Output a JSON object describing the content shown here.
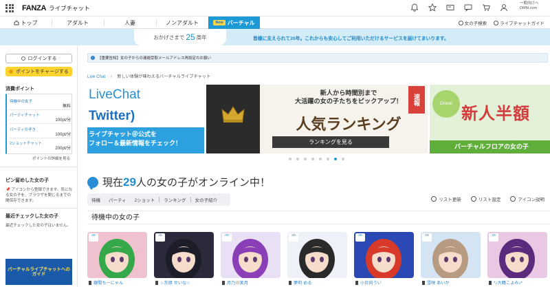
{
  "header": {
    "logo": "FANZA",
    "logo_sub": "ライブチャット",
    "account_line1": "一般向けへ",
    "account_line2": "DMM.com"
  },
  "nav": {
    "tabs": [
      {
        "label": "トップ"
      },
      {
        "label": "アダルト"
      },
      {
        "label": "人妻"
      },
      {
        "label": "ノンアダルト"
      },
      {
        "label": "バーチャル",
        "badge": "New"
      }
    ],
    "right": [
      "女の子検索",
      "ライブチャットガイド"
    ]
  },
  "anniversary": {
    "prefix": "おかげさまで",
    "years": "25",
    "suffix": "周年",
    "message": "皆様に支えられて25年。これからも安心してご利用いただけるサービスを届けてまいります。"
  },
  "sidebar": {
    "login": "ログインする",
    "charge": "ポイントをチャージする",
    "points_title": "消費ポイント",
    "points": [
      {
        "label": "待機中の女子",
        "value": "無料"
      },
      {
        "label": "パーティチャット",
        "value": "100pt/分"
      },
      {
        "label": "パーティのぞき",
        "value": "100pt/分"
      },
      {
        "label": "2ショットチャット",
        "value": "200pt/分"
      }
    ],
    "points_more": "ポイントの詳細を見る",
    "pinned_title": "ピン留めした女の子",
    "pinned_text": "📌 アイコンから登録できます。気になる女の子を、ブラウザを閉じるまでの間保存できます。",
    "recent_title": "最近チェックした女の子",
    "recent_text": "最近チェックした女の子はいません。",
    "banner_text": "バーチャルライブチャットへのガイド"
  },
  "notice": {
    "tag": "【重要告知】",
    "text": "女の子からの連絡受取メールアドレス再設定のお願い"
  },
  "breadcrumb": {
    "home": "Live Chat",
    "current": "新しい体験が味わえるバーチャルライブチャット"
  },
  "carousel": {
    "slide1": {
      "line1": "LiveChat",
      "line2": "Twitter)",
      "line3": "ライブチャット＠公式を\nフォロー＆最新情報をチェック！"
    },
    "slide2": {
      "line1": "新人から時間別まで\n大活躍の女の子たちをピックアップ！",
      "title": "人気ランキング",
      "button": "ランキングを見る",
      "ribbon": "速報"
    },
    "slide3": {
      "circle": "Check!",
      "title": "新人半額",
      "bar": "バーチャルフロアの女の子"
    },
    "dots": 8,
    "active_dot": 6
  },
  "online": {
    "prefix": "現在",
    "count": "29",
    "suffix": "人の女の子がオンライン中！"
  },
  "filters": [
    "待機",
    "パーティ",
    "2ショット",
    "ランキング",
    "女の子紹介"
  ],
  "tools": [
    "リスト更新",
    "リスト設定",
    "アイコン説明"
  ],
  "section_title": "待機中の女の子",
  "cards": [
    {
      "name": "鏡間ちーにゃん",
      "badge": "2D",
      "bg": "#f0c2cf",
      "hair": "#35a84a"
    },
    {
      "name": "☆灰原 せいな☆",
      "badge": "3D",
      "bg": "#2a2a3c",
      "hair": "#1d1d2a"
    },
    {
      "name": "月乃川美月",
      "badge": "2D",
      "bg": "#e9e0f5",
      "hair": "#8a3fb6"
    },
    {
      "name": "夢莉 める",
      "badge": "2D",
      "bg": "#eef2f8",
      "hair": "#2a2a2a"
    },
    {
      "name": "小日向うい",
      "badge": "3D",
      "bg": "#2b49b5",
      "hair": "#d83a2a"
    },
    {
      "name": "雪咲 あいか",
      "badge": "3D",
      "bg": "#d4e4f2",
      "hair": "#b69a82"
    },
    {
      "name": "*♪大鶴こよみ♪*",
      "badge": "2D",
      "bg": "#e9c8e4",
      "hair": "#5c2a7c"
    }
  ],
  "colors": {
    "accent": "#1d9ad6",
    "charge": "#ffd42e",
    "link": "#1d8ed0"
  }
}
